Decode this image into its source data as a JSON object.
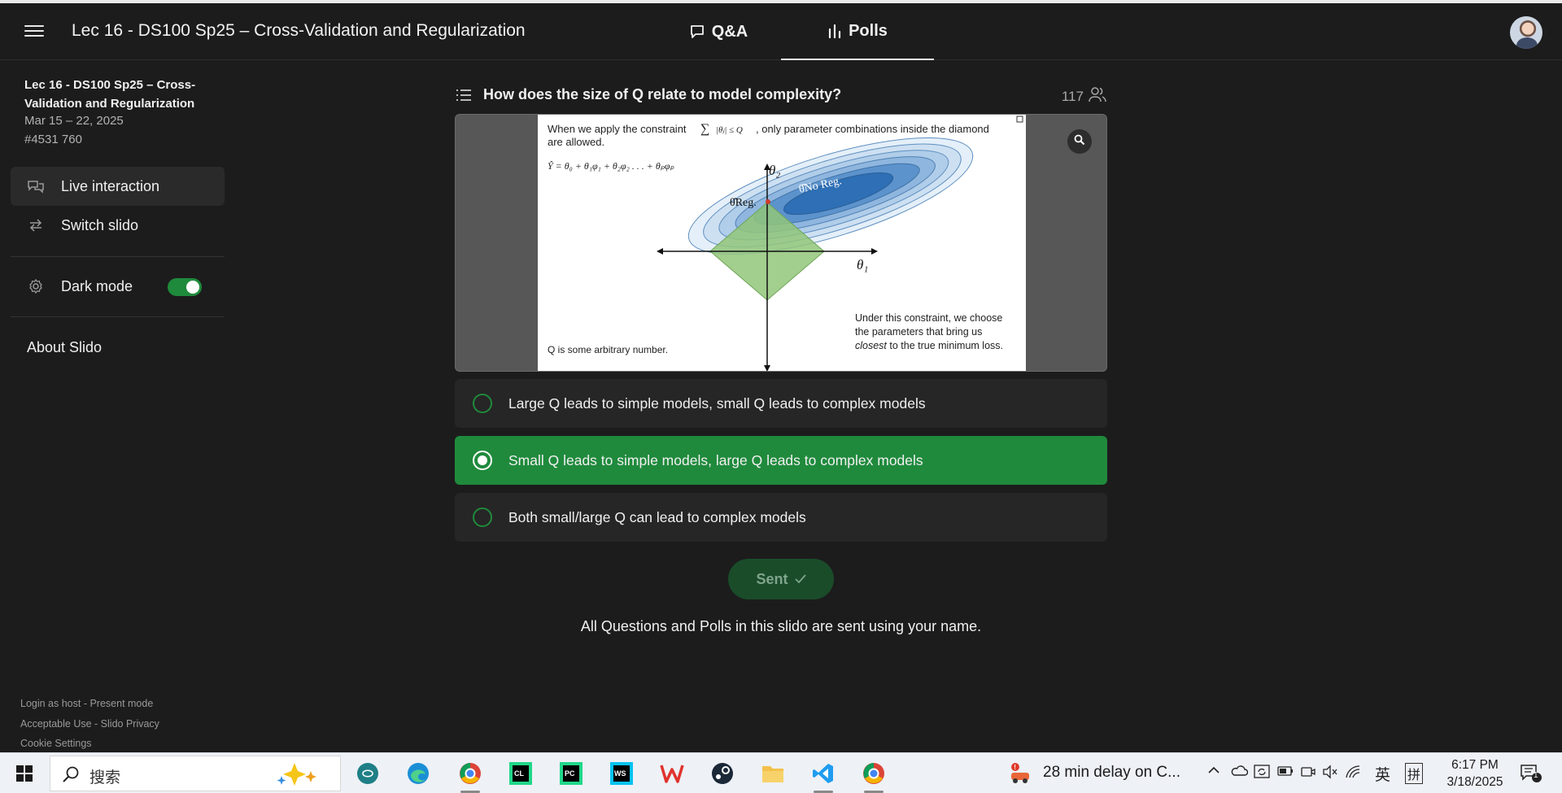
{
  "header": {
    "title": "Lec 16 - DS100 Sp25 – Cross-Validation and Regularization",
    "tabs": [
      {
        "label": "Q&A",
        "icon": "chat-bubble-icon"
      },
      {
        "label": "Polls",
        "icon": "bar-chart-icon",
        "active": true
      }
    ]
  },
  "sidebar": {
    "event_title": "Lec 16 - DS100 Sp25 – Cross-Validation and Regularization",
    "event_date": "Mar 15 – 22, 2025",
    "event_code": "#4531 760",
    "items": [
      {
        "label": "Live interaction",
        "icon": "chat-bubbles-icon",
        "active": true
      },
      {
        "label": "Switch slido",
        "icon": "swap-arrows-icon"
      }
    ],
    "dark_mode_label": "Dark mode",
    "dark_mode_on": true,
    "about_label": "About Slido",
    "footer": {
      "login": "Login as host",
      "present": "Present mode",
      "acceptable_use": "Acceptable Use",
      "privacy": "Slido Privacy",
      "cookie": "Cookie Settings",
      "sep": " - "
    }
  },
  "poll": {
    "question": "How does the size of Q relate to model complexity?",
    "participants": "117",
    "slide": {
      "line1_a": "When we apply the constraint",
      "line1_b": ", only parameter combinations inside the diamond",
      "line2": "are allowed.",
      "model_eq": "Ŷ = θ₀ + θ₁φ₁ + θ₂φ₂ . . . + θₚφₚ",
      "theta2": "θ₂",
      "theta1": "θ₁",
      "reg_label": "θ̂Reg.",
      "noreg_label": "θ̂No Reg.",
      "right_note1": "Under this constraint, we choose",
      "right_note2": "the parameters that bring us",
      "right_note3_em": "closest",
      "right_note3_rest": " to the true minimum loss.",
      "left_note": "Q is some arbitrary number."
    },
    "options": [
      {
        "label": "Large Q leads to simple models, small Q leads to complex models",
        "selected": false
      },
      {
        "label": "Small Q leads to simple models, large Q leads to complex models",
        "selected": true
      },
      {
        "label": "Both small/large Q can lead to complex models",
        "selected": false
      }
    ],
    "sent_label": "Sent",
    "note": "All Questions and Polls in this slido are sent using your name."
  },
  "taskbar": {
    "search_label": "搜索",
    "news": "28 min delay on C...",
    "ime1": "英",
    "ime2": "拼",
    "time": "6:17 PM",
    "date": "3/18/2025",
    "notif_count": "1"
  },
  "colors": {
    "accent": "#1f8a3c",
    "background": "#1c1c1c",
    "option_bg": "#262626"
  }
}
